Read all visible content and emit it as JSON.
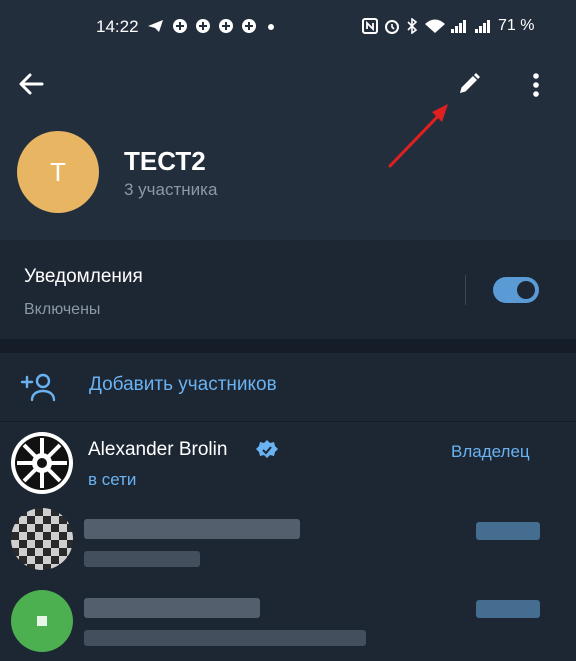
{
  "status_bar": {
    "time": "14:22",
    "battery": "71 %"
  },
  "header": {
    "group_title": "ТЕСТ2",
    "avatar_letter": "Т",
    "subtitle": "3 участника"
  },
  "notifications": {
    "title": "Уведомления",
    "state": "Включены",
    "enabled": true
  },
  "add_members": {
    "label": "Добавить участников"
  },
  "members": [
    {
      "name": "Alexander Brolin",
      "status": "в сети",
      "role": "Владелец"
    }
  ],
  "colors": {
    "background": "#1d2733",
    "header": "#232e3c",
    "accent": "#6ab2f2",
    "avatar": "#e8b563",
    "annotation_arrow": "#e02020"
  },
  "icons": [
    "back-arrow-icon",
    "pencil-icon",
    "more-vertical-icon",
    "add-user-icon",
    "verified-badge-icon",
    "empire-avatar"
  ]
}
